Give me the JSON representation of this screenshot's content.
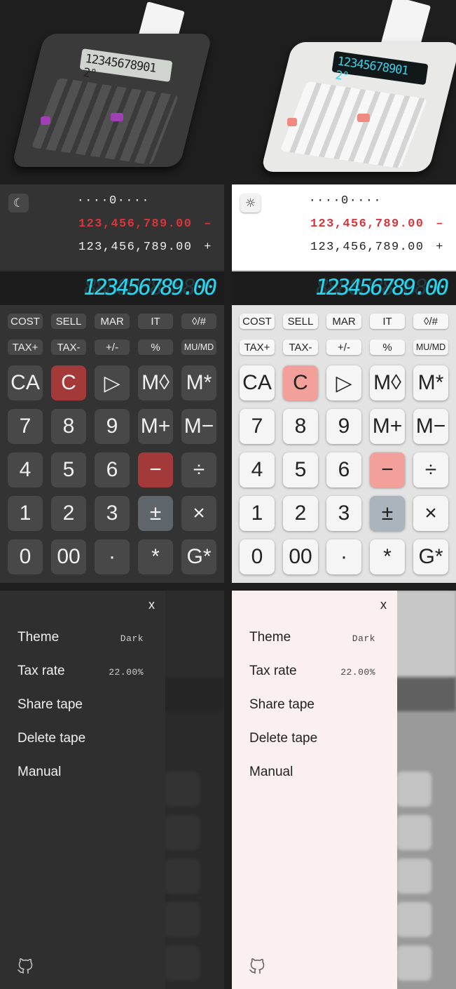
{
  "hero": {
    "dark_lcd": "12345678901 2°",
    "light_lcd": "12345678901 2°"
  },
  "calculators": [
    {
      "theme": "dark",
      "theme_icon": "moon-icon",
      "theme_glyph": "☾",
      "tape": [
        {
          "text": "····0····",
          "sym": ""
        },
        {
          "text": "123,456,789.00",
          "sym": "–"
        },
        {
          "text": "123,456,789.00",
          "sym": "+"
        }
      ],
      "display_ghost": "888888888888",
      "display": "123456789.00"
    },
    {
      "theme": "light",
      "theme_icon": "sun-icon",
      "theme_glyph": "☼",
      "tape": [
        {
          "text": "····0····",
          "sym": ""
        },
        {
          "text": "123,456,789.00",
          "sym": "–"
        },
        {
          "text": "123,456,789.00",
          "sym": "+"
        }
      ],
      "display_ghost": "888888888888",
      "display": "123456789.00"
    }
  ],
  "function_keys": [
    [
      "COST",
      "SELL",
      "MAR",
      "IT",
      "◊/#"
    ],
    [
      "TAX+",
      "TAX-",
      "+/-",
      "%",
      "MU/MD"
    ]
  ],
  "keypad": [
    [
      "CA",
      "C",
      "▷",
      "M◊",
      "M*"
    ],
    [
      "7",
      "8",
      "9",
      "M+",
      "M−"
    ],
    [
      "4",
      "5",
      "6",
      "−",
      "÷"
    ],
    [
      "1",
      "2",
      "3",
      "±",
      "×"
    ],
    [
      "0",
      "00",
      "·",
      "*",
      "G*"
    ]
  ],
  "menus": [
    {
      "close": "x",
      "items": [
        {
          "label": "Theme",
          "value": "Dark"
        },
        {
          "label": "Tax rate",
          "value": "22.00%"
        },
        {
          "label": "Share tape",
          "value": ""
        },
        {
          "label": "Delete tape",
          "value": ""
        },
        {
          "label": "Manual",
          "value": ""
        }
      ],
      "footer_icon": "github-icon"
    },
    {
      "close": "x",
      "items": [
        {
          "label": "Theme",
          "value": "Dark"
        },
        {
          "label": "Tax rate",
          "value": "22.00%"
        },
        {
          "label": "Share tape",
          "value": ""
        },
        {
          "label": "Delete tape",
          "value": ""
        },
        {
          "label": "Manual",
          "value": ""
        }
      ],
      "footer_icon": "github-icon"
    }
  ],
  "colors": {
    "dark_red_key": "#a33a39",
    "light_red_key": "#f4a09a",
    "lcd_cyan": "#28d6f0",
    "tape_negative": "#d9353a"
  }
}
